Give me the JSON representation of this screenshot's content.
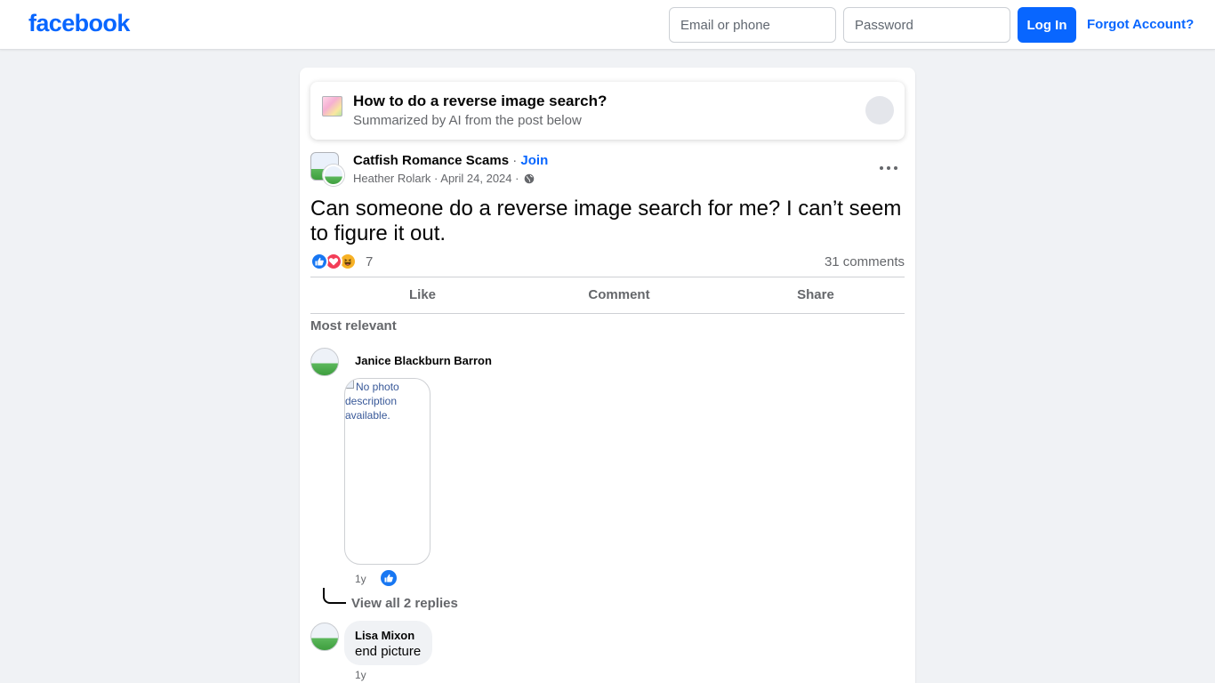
{
  "header": {
    "logo": "facebook",
    "email_placeholder": "Email or phone",
    "password_placeholder": "Password",
    "login_label": "Log In",
    "forgot_label": "Forgot Account?"
  },
  "ai_summary": {
    "title": "How to do a reverse image search?",
    "subtitle": "Summarized by AI from the post below"
  },
  "post": {
    "group_name": "Catfish Romance Scams",
    "separator": " · ",
    "join_label": "Join",
    "author": "Heather Rolark",
    "date": "April 24, 2024",
    "meta_separator": " · ",
    "text": "Can someone do a reverse image search for me? I can’t seem to figure it out.",
    "reaction_count": "7",
    "reactions": [
      "like-icon",
      "love-icon",
      "haha-icon"
    ],
    "comments_count": "31 comments"
  },
  "actions": {
    "like": "Like",
    "comment": "Comment",
    "share": "Share"
  },
  "comments": {
    "sort_label": "Most relevant",
    "items": [
      {
        "name": "Janice Blackburn Barron",
        "photo_alt": "No photo description available.",
        "time": "1y",
        "view_replies": "View all 2 replies"
      },
      {
        "name": "Lisa Mixon",
        "text": "end picture",
        "time": "1y"
      }
    ]
  },
  "colors": {
    "brand": "#0866ff",
    "background": "#f0f2f5",
    "like": "#1877f2",
    "love": "#f33e58",
    "haha": "#f7b125"
  }
}
